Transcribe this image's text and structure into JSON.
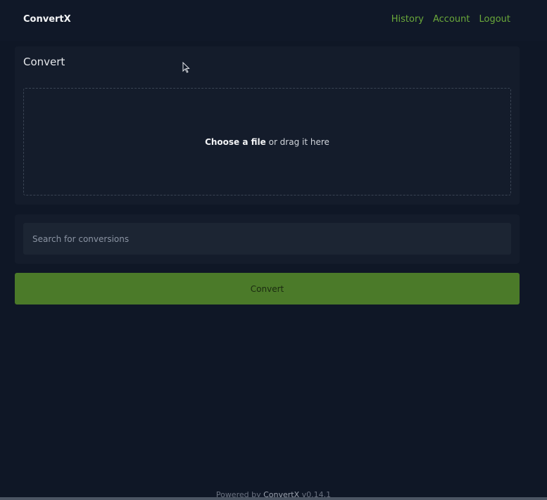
{
  "header": {
    "brand": "ConvertX",
    "nav": {
      "history": "History",
      "account": "Account",
      "logout": "Logout"
    }
  },
  "upload": {
    "title": "Convert",
    "choose": "Choose a file",
    "drag": " or drag it here"
  },
  "search": {
    "placeholder": "Search for conversions"
  },
  "convert_button": "Convert",
  "footer": {
    "prefix": "Powered by ",
    "brand": "ConvertX",
    "version": " v0.14.1"
  },
  "colors": {
    "background": "#0f1726",
    "card": "#141c2b",
    "accent": "#6aa83a",
    "button": "#4b7a29"
  }
}
